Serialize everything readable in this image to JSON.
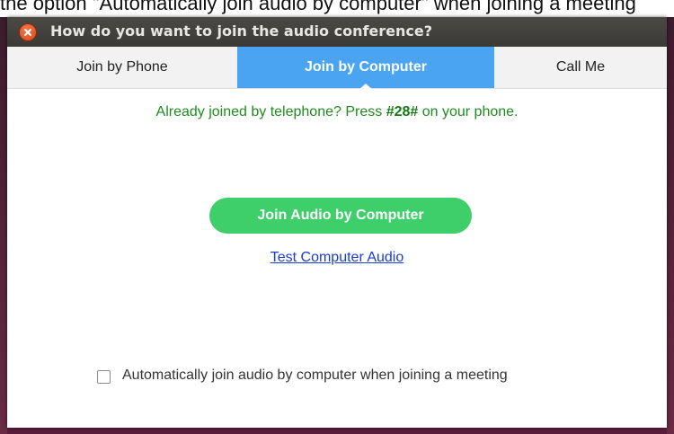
{
  "background_caption": "the option \"Automatically join audio by computer\" when joining a meeting",
  "dialog": {
    "title": "How do you want to join the audio conference?",
    "tabs": [
      {
        "label": "Join by Phone",
        "active": false
      },
      {
        "label": "Join by Computer",
        "active": true
      },
      {
        "label": "Call Me",
        "active": false
      }
    ],
    "notice": {
      "prefix": "Already joined by telephone? Press ",
      "code": "#28#",
      "suffix": " on your phone."
    },
    "join_button_label": "Join Audio by Computer",
    "test_link_label": "Test Computer Audio",
    "auto_join": {
      "label": "Automatically join audio by computer when joining a meeting",
      "checked": false
    }
  },
  "colors": {
    "active_tab": "#4aa4f2",
    "join_button": "#3fcf6a",
    "notice_text": "#1e8c1e",
    "link": "#1a3cd6",
    "titlebar": "#3b3a36",
    "close_button": "#dd4814"
  },
  "icons": {
    "close": "close-icon"
  }
}
